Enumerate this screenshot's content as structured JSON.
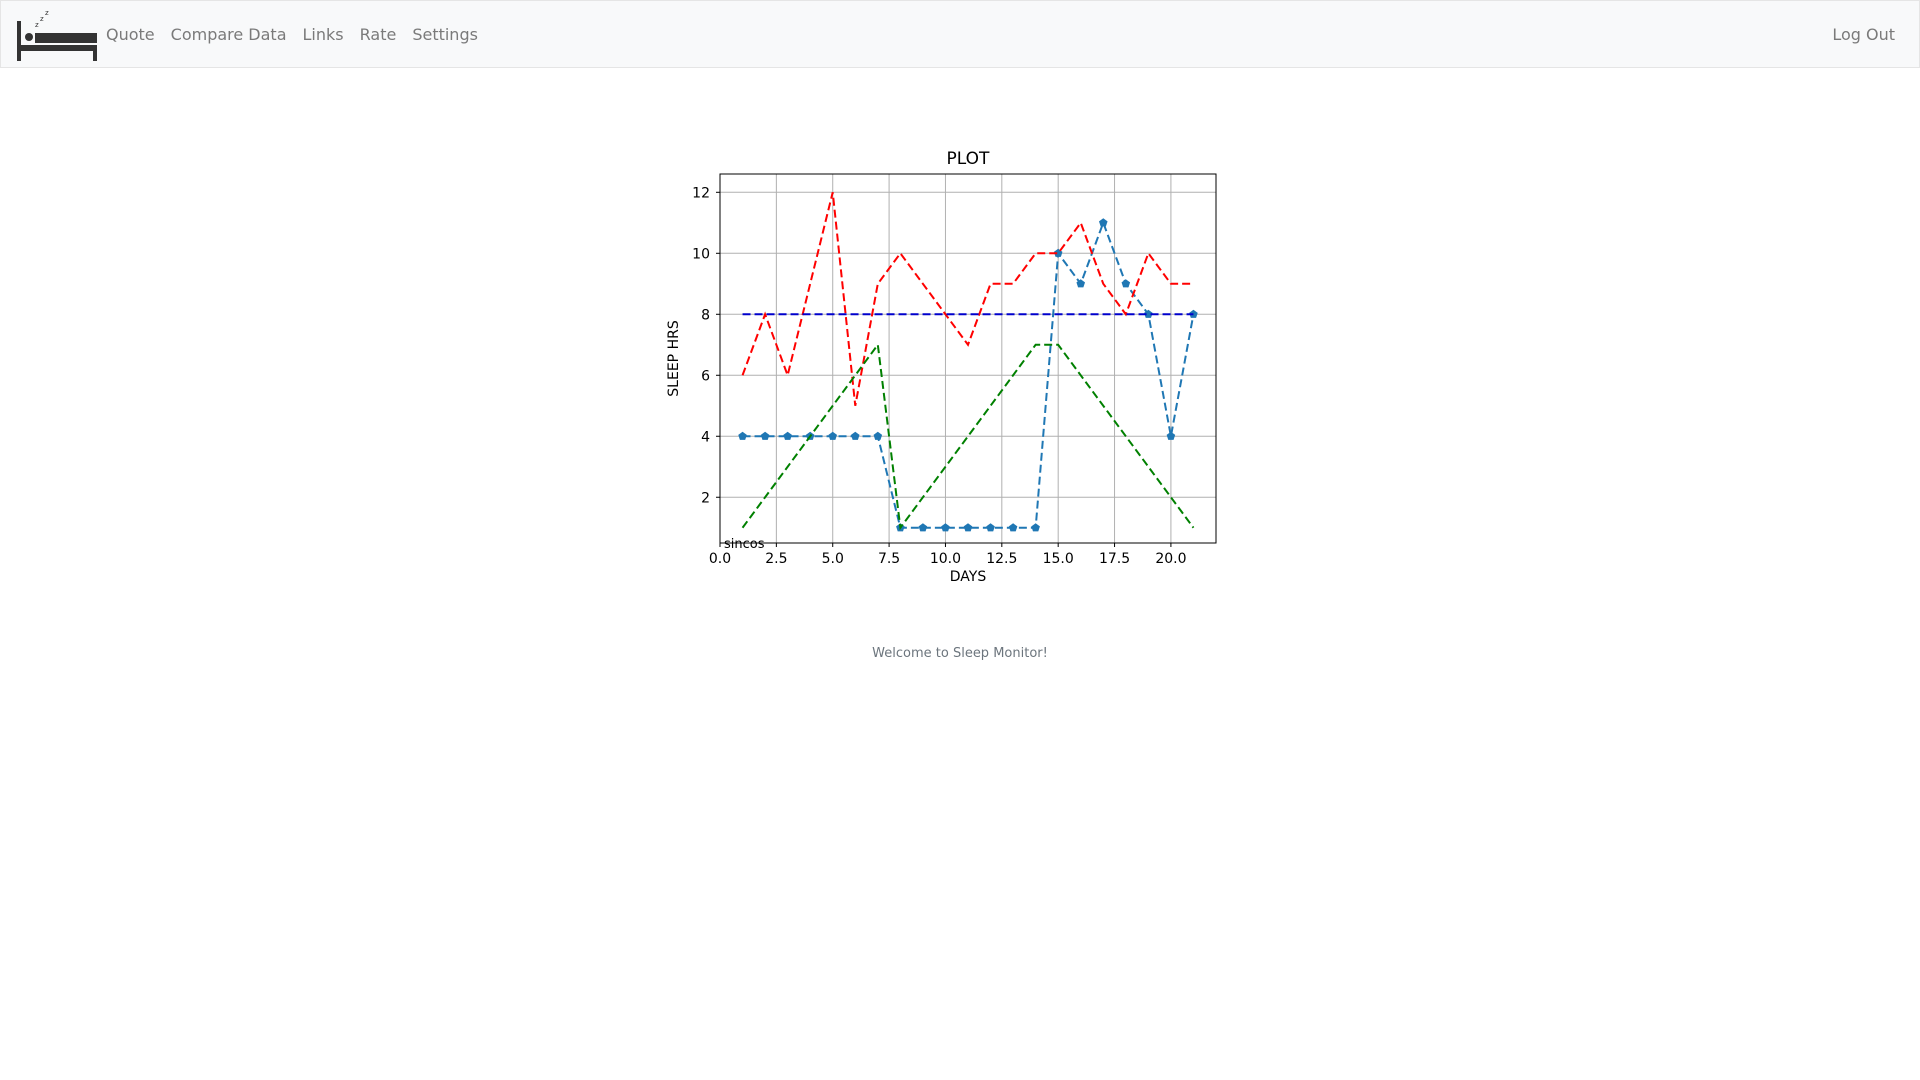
{
  "nav": {
    "links": [
      "Quote",
      "Compare Data",
      "Links",
      "Rate",
      "Settings"
    ],
    "logout": "Log Out"
  },
  "chart_data": {
    "type": "line",
    "title": "PLOT",
    "xlabel": "DAYS",
    "ylabel": "SLEEP HRS",
    "xlim": [
      0.0,
      22.0
    ],
    "ylim": [
      0.5,
      12.6
    ],
    "xticks": [
      0.0,
      2.5,
      5.0,
      7.5,
      10.0,
      12.5,
      15.0,
      17.5,
      20.0
    ],
    "xtick_labels": [
      "0.0",
      "2.5",
      "5.0",
      "7.5",
      "10.0",
      "12.5",
      "15.0",
      "17.5",
      "20.0"
    ],
    "yticks": [
      2,
      4,
      6,
      8,
      10,
      12
    ],
    "ytick_labels": [
      "2",
      "4",
      "6",
      "8",
      "10",
      "12"
    ],
    "grid": true,
    "annotation": "sincos",
    "series": [
      {
        "color": "#1f77b4",
        "style": "dashed",
        "marker": "pentagon",
        "x": [
          1,
          2,
          3,
          4,
          5,
          6,
          7,
          8,
          9,
          10,
          11,
          12,
          13,
          14,
          15,
          16,
          17,
          18,
          19,
          20,
          21
        ],
        "values": [
          4,
          4,
          4,
          4,
          4,
          4,
          4,
          1,
          1,
          1,
          1,
          1,
          1,
          1,
          10,
          9,
          11,
          9,
          8,
          4,
          8
        ]
      },
      {
        "color": "#ff0000",
        "style": "dashed",
        "marker": "none",
        "x": [
          1,
          2,
          3,
          4,
          5,
          6,
          7,
          8,
          9,
          10,
          11,
          12,
          13,
          14,
          15,
          16,
          17,
          18,
          19,
          20,
          21
        ],
        "values": [
          6,
          8,
          6,
          9,
          12,
          5,
          9,
          10,
          9,
          8,
          7,
          9,
          9,
          10,
          10,
          11,
          9,
          8,
          10,
          9,
          9
        ]
      },
      {
        "color": "#008000",
        "style": "dashed",
        "marker": "none",
        "x": [
          1,
          7,
          8,
          14,
          15,
          21
        ],
        "values": [
          1,
          7,
          1,
          7,
          7,
          1
        ]
      },
      {
        "color": "#0000cc",
        "style": "dashed",
        "marker": "none",
        "x": [
          1,
          21
        ],
        "values": [
          8,
          8
        ]
      }
    ]
  },
  "footer": {
    "welcome": "Welcome to Sleep Monitor!"
  }
}
